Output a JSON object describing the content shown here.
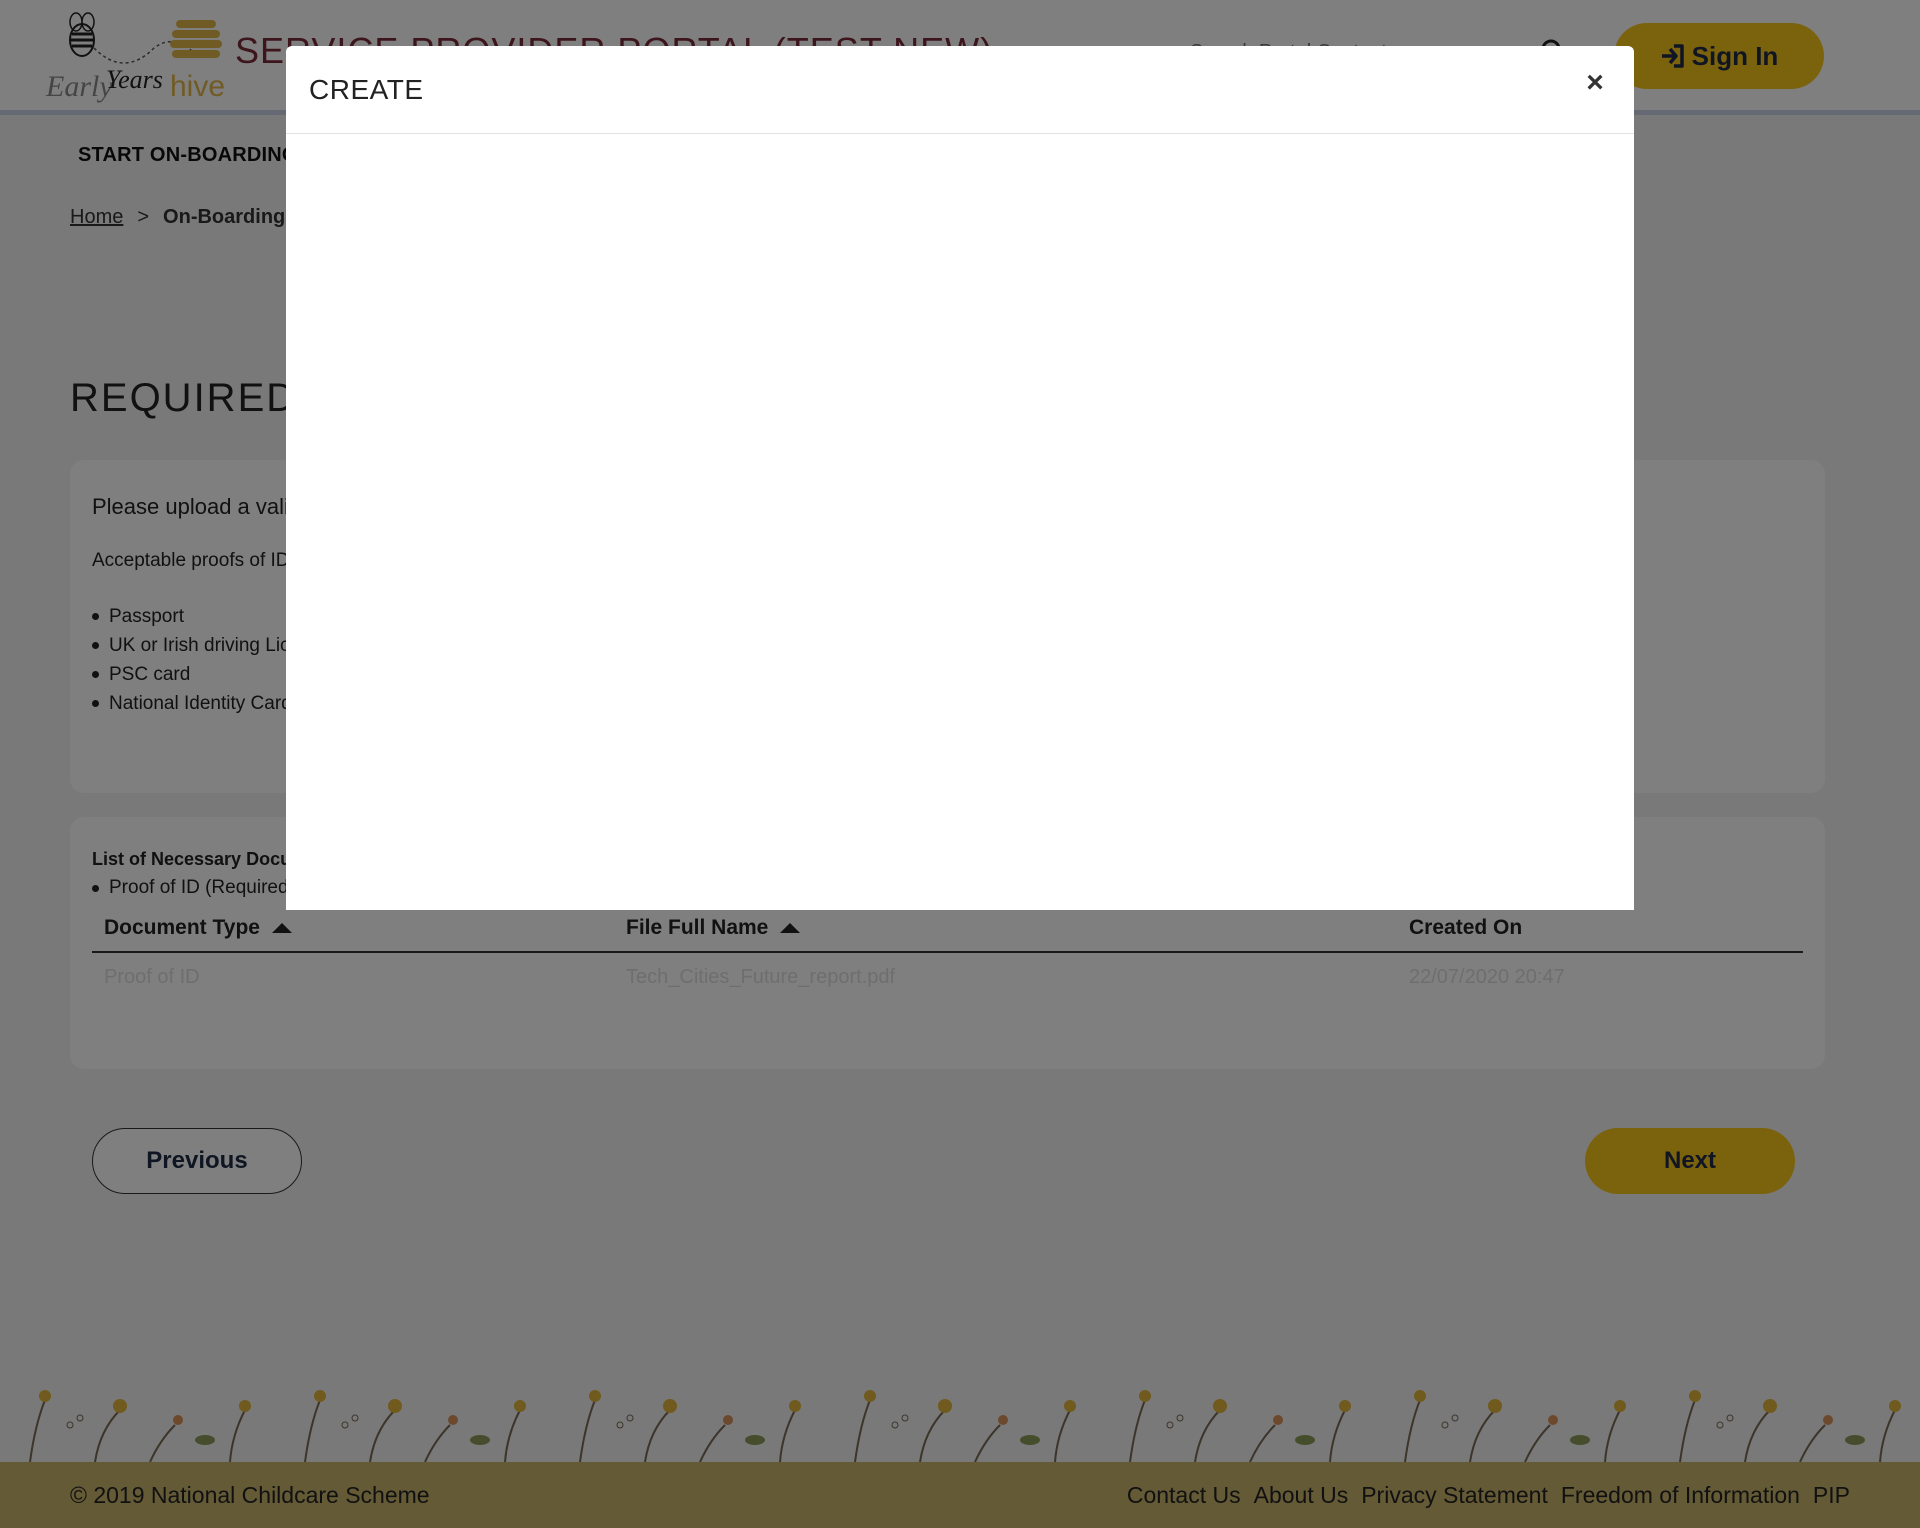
{
  "header": {
    "portal_title": "SERVICE PROVIDER PORTAL (TEST NEW)",
    "search_placeholder": "Search Portal Content",
    "signin_label": "Sign In",
    "logo_text_early": "Early",
    "logo_text_years": "Years",
    "logo_text_hive": "hive"
  },
  "nav": {
    "items": [
      {
        "label": "START ON-BOARDING"
      }
    ]
  },
  "breadcrumb": {
    "home": "Home",
    "separator": ">",
    "current": "On-Boarding Process"
  },
  "page": {
    "heading": "REQUIRED DOCUMENTS"
  },
  "info_card": {
    "intro": "Please upload a valid proof of identification.",
    "subintro": "Acceptable proofs of ID:",
    "id_types": [
      "Passport",
      "UK or Irish driving Licence",
      "PSC card",
      "National Identity Card"
    ]
  },
  "docs_card": {
    "title": "List of Necessary Documents",
    "required": "Proof of ID (Required)",
    "columns": [
      "Document Type",
      "File Full Name",
      "Created On"
    ],
    "rows": [
      {
        "document_type": "Proof of ID",
        "file_name": "Tech_Cities_Future_report.pdf",
        "created_on": "22/07/2020 20:47"
      }
    ]
  },
  "pager": {
    "previous": "Previous",
    "next": "Next"
  },
  "footer": {
    "copyright": "© 2019 National Childcare Scheme",
    "links": [
      "Contact Us",
      "About Us",
      "Privacy Statement",
      "Freedom of Information",
      "PIP"
    ]
  },
  "modal": {
    "title": "CREATE",
    "close": "×"
  },
  "colors": {
    "accent": "#f6c51b",
    "title": "#7a2a3a",
    "footer": "#c8b46a"
  }
}
